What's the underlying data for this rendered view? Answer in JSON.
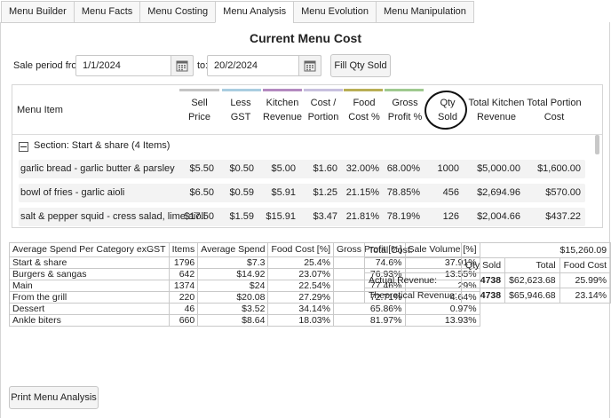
{
  "tabs": [
    {
      "label": "Menu Builder",
      "active": false
    },
    {
      "label": "Menu Facts",
      "active": false
    },
    {
      "label": "Menu Costing",
      "active": false
    },
    {
      "label": "Menu Analysis",
      "active": true
    },
    {
      "label": "Menu Evolution",
      "active": false
    },
    {
      "label": "Menu Manipulation",
      "active": false
    }
  ],
  "page_title": "Current Menu Cost",
  "filters": {
    "sale_period_label": "Sale period from:",
    "from_date": "1/1/2024",
    "to_label": "to:",
    "to_date": "20/2/2024",
    "fill_button": "Fill Qty Sold"
  },
  "grid": {
    "headers": {
      "menu_item": "Menu Item",
      "sell_price": [
        "Sell",
        "Price"
      ],
      "less_gst": [
        "Less",
        "GST"
      ],
      "kitchen_revenue": [
        "Kitchen",
        "Revenue"
      ],
      "cost_portion": [
        "Cost /",
        "Portion"
      ],
      "food_pct": [
        "Food",
        "Cost %"
      ],
      "gross_profit": [
        "Gross",
        "Profit %"
      ],
      "qty_sold": [
        "Qty",
        "Sold"
      ],
      "total_kitchen_revenue": [
        "Total Kitchen",
        "Revenue"
      ],
      "total_portion_cost": [
        "Total Portion",
        "Cost"
      ]
    },
    "header_bar_colors": [
      "#c4c4c4",
      "#a9cde0",
      "#b38ac0",
      "#c7c0de",
      "#b8ae55",
      "#9fc98f"
    ],
    "section": "Section: Start & share (4 Items)",
    "rows": [
      {
        "item": "garlic bread - garlic butter & parsley",
        "sell": "$5.50",
        "gst": "$0.50",
        "kitchen": "$5.00",
        "cost": "$1.60",
        "food_pct": "32.00%",
        "gross": "68.00%",
        "qty": "1000",
        "total_rev": "$5,000.00",
        "total_cost": "$1,600.00"
      },
      {
        "item": "bowl of fries - garlic aioli",
        "sell": "$6.50",
        "gst": "$0.59",
        "kitchen": "$5.91",
        "cost": "$1.25",
        "food_pct": "21.15%",
        "gross": "78.85%",
        "qty": "456",
        "total_rev": "$2,694.96",
        "total_cost": "$570.00"
      },
      {
        "item": "salt & pepper squid - cress salad, lime aioli",
        "sell": "$17.50",
        "gst": "$1.59",
        "kitchen": "$15.91",
        "cost": "$3.47",
        "food_pct": "21.81%",
        "gross": "78.19%",
        "qty": "126",
        "total_rev": "$2,004.66",
        "total_cost": "$437.22"
      }
    ]
  },
  "category_table": {
    "headers": [
      "Average Spend Per Category exGST",
      "Items",
      "Average Spend",
      "Food Cost [%]",
      "Gross Profit [%]",
      "Sale Volume [%]"
    ],
    "rows": [
      [
        "Start & share",
        "1796",
        "$7.3",
        "25.4%",
        "74.6%",
        "37.91%"
      ],
      [
        "Burgers & sangas",
        "642",
        "$14.92",
        "23.07%",
        "76.93%",
        "13.55%"
      ],
      [
        "Main",
        "1374",
        "$24",
        "22.54%",
        "77.46%",
        "29%"
      ],
      [
        "From the grill",
        "220",
        "$20.08",
        "27.29%",
        "72.71%",
        "4.64%"
      ],
      [
        "Dessert",
        "46",
        "$3.52",
        "34.14%",
        "65.86%",
        "0.97%"
      ],
      [
        "Ankle biters",
        "660",
        "$8.64",
        "18.03%",
        "81.97%",
        "13.93%"
      ]
    ]
  },
  "cost_table": {
    "total_cost_label": "Total Cost:",
    "total_cost_value": "$15,260.09",
    "col_headers": [
      "Qty Sold",
      "Total",
      "Food Cost"
    ],
    "actual": {
      "label": "Actual Revenue:",
      "qty": "4738",
      "total": "$62,623.68",
      "food_cost": "25.99%"
    },
    "theoretical": {
      "label": "Theoretical Revenue:",
      "qty": "4738",
      "total": "$65,946.68",
      "food_cost": "23.14%"
    }
  },
  "print_button": "Print Menu Analysis"
}
